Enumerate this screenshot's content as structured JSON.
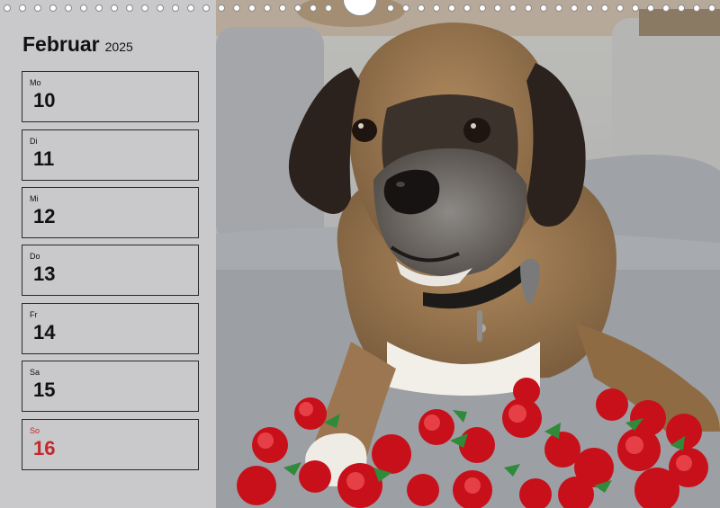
{
  "calendar": {
    "month": "Februar",
    "year": "2025",
    "days": [
      {
        "weekday": "Mo",
        "day": "10"
      },
      {
        "weekday": "Di",
        "day": "11"
      },
      {
        "weekday": "Mi",
        "day": "12"
      },
      {
        "weekday": "Do",
        "day": "13"
      },
      {
        "weekday": "Fr",
        "day": "14"
      },
      {
        "weekday": "Sa",
        "day": "15"
      },
      {
        "weekday": "So",
        "day": "16"
      }
    ]
  },
  "colors": {
    "panel": "#c9c9cb",
    "sunday": "#c2282c",
    "text": "#111111"
  }
}
